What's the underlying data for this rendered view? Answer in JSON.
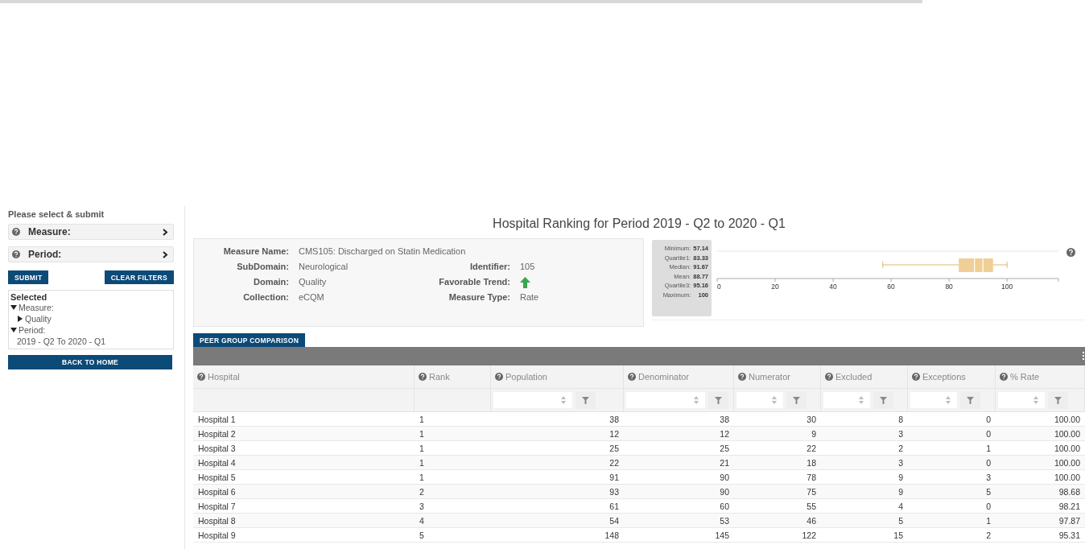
{
  "sidebar": {
    "title": "Please select & submit",
    "filters": [
      {
        "label": "Measure:"
      },
      {
        "label": "Period:"
      }
    ],
    "buttons": [
      "SUBMIT",
      "CLEAR FILTERS"
    ],
    "selected": {
      "title": "Selected",
      "tree": [
        {
          "label": "Measure:",
          "expanded": true,
          "children": [
            {
              "label": "Quality",
              "expanded": false
            }
          ]
        },
        {
          "label": "Period:",
          "expanded": true,
          "children": [
            {
              "label": "2019 - Q2 To 2020 - Q1"
            }
          ]
        }
      ]
    },
    "home_button": "BACK TO HOME"
  },
  "main": {
    "title": "Hospital Ranking for Period 2019 - Q2 to 2020 - Q1",
    "info": {
      "left": [
        {
          "label": "Measure Name:",
          "value": "CMS105: Discharged on Statin Medication"
        },
        {
          "label": "SubDomain:",
          "value": "Neurological"
        },
        {
          "label": "Domain:",
          "value": "Quality"
        },
        {
          "label": "Collection:",
          "value": "eCQM"
        }
      ],
      "right": [
        {
          "label": "Identifier:",
          "kind": "text",
          "value": "105"
        },
        {
          "label": "Favorable Trend:",
          "kind": "trend",
          "up": true
        },
        {
          "label": "Measure Type:",
          "kind": "text",
          "value": "Rate"
        }
      ]
    },
    "boxplot": {
      "stats": [
        {
          "label": "Minimum:",
          "value": "57.14"
        },
        {
          "label": "Quartile1:",
          "value": "83.33"
        },
        {
          "label": "Median:",
          "value": "91.67"
        },
        {
          "label": "Mean:",
          "value": "88.77"
        },
        {
          "label": "Quartile3:",
          "value": "95.16"
        },
        {
          "label": "Maximum:",
          "value": "100"
        }
      ],
      "ticks": [
        "0",
        "20",
        "40",
        "60",
        "80",
        "100"
      ]
    },
    "peer_button": "PEER GROUP COMPARISON",
    "table": {
      "columns": [
        {
          "label": "Hospital",
          "filter": false
        },
        {
          "label": "Rank",
          "filter": false
        },
        {
          "label": "Population",
          "filter": true
        },
        {
          "label": "Denominator",
          "filter": true
        },
        {
          "label": "Numerator",
          "filter": true
        },
        {
          "label": "Excluded",
          "filter": true
        },
        {
          "label": "Exceptions",
          "filter": true
        },
        {
          "label": "% Rate",
          "filter": true
        }
      ],
      "rows": [
        [
          "Hospital 1",
          "1",
          "38",
          "38",
          "30",
          "8",
          "0",
          "100.00"
        ],
        [
          "Hospital 2",
          "1",
          "12",
          "12",
          "9",
          "3",
          "0",
          "100.00"
        ],
        [
          "Hospital 3",
          "1",
          "25",
          "25",
          "22",
          "2",
          "1",
          "100.00"
        ],
        [
          "Hospital 4",
          "1",
          "22",
          "21",
          "18",
          "3",
          "0",
          "100.00"
        ],
        [
          "Hospital 5",
          "1",
          "91",
          "90",
          "78",
          "9",
          "3",
          "100.00"
        ],
        [
          "Hospital 6",
          "2",
          "93",
          "90",
          "75",
          "9",
          "5",
          "98.68"
        ],
        [
          "Hospital 7",
          "3",
          "61",
          "60",
          "55",
          "4",
          "0",
          "98.21"
        ],
        [
          "Hospital 8",
          "4",
          "54",
          "53",
          "46",
          "5",
          "1",
          "97.87"
        ],
        [
          "Hospital 9",
          "5",
          "148",
          "145",
          "122",
          "15",
          "2",
          "95.31"
        ]
      ]
    }
  }
}
